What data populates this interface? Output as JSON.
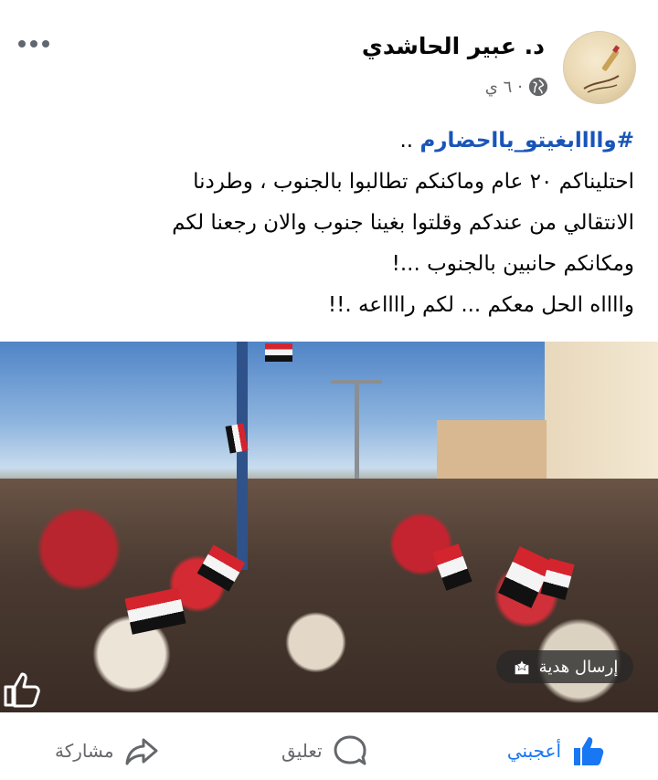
{
  "post": {
    "author_name": "د. عبير الحاشدي",
    "timestamp": "٦ ي",
    "separator": "·",
    "privacy_icon": "globe-icon",
    "more_icon": "more-options-icon",
    "hashtag": "#واااابغيتو_يااحضارم",
    "hashtag_suffix": "..",
    "lines": [
      "احتليناكم ٢٠ عام وماكنكم تطالبوا بالجنوب ، وطردنا",
      "الانتقالي من عندكم وقلتوا بغينا جنوب والان رجعنا لكم",
      "ومكانكم حانبين بالجنوب ...!",
      "وااااه الحل معكم ... لكم رااااعه .!!"
    ]
  },
  "media": {
    "type": "video-thumbnail",
    "description_icon": "crowd-rally-photo",
    "gift_button_label": "إرسال هدية",
    "gift_icon": "gift-sparkle-icon",
    "overlay_icon": "thumbs-up-outline-icon"
  },
  "actions": {
    "like_label": "أعجبني",
    "like_icon": "thumbs-up-icon",
    "comment_label": "تعليق",
    "comment_icon": "comment-bubble-icon",
    "share_label": "مشاركة",
    "share_icon": "share-arrow-icon"
  },
  "colors": {
    "accent": "#1877f2",
    "hashtag": "#1a55b8",
    "secondary_text": "#65676b",
    "primary_text": "#050505"
  }
}
